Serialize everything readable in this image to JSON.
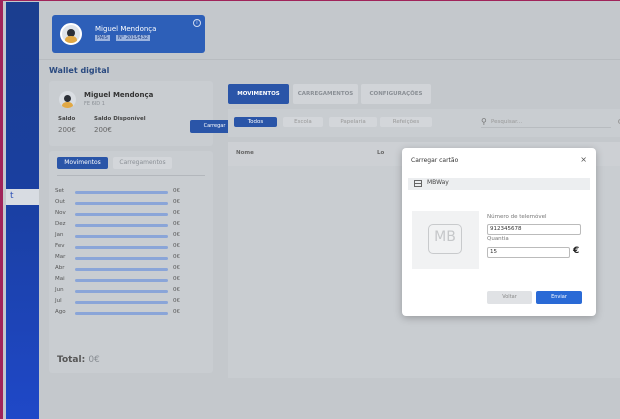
{
  "sidebar": {
    "selected_item_text": "t"
  },
  "user": {
    "name": "Miguel Mendonça",
    "badge1": "PAIS",
    "badge2": "N° 2015432",
    "info": "i"
  },
  "wallet": {
    "title": "Wallet digital",
    "name": "Miguel Mendonça",
    "sub": "FE 6ID 1",
    "saldo_label": "Saldo",
    "saldo_value": "200€",
    "disponivel_label": "Saldo Disponível",
    "disponivel_value": "200€",
    "carregar_label": "Carregar"
  },
  "history": {
    "tabs": [
      "Movimentos",
      "Carregamentos"
    ],
    "rows": [
      {
        "month": "Set",
        "value": "0€"
      },
      {
        "month": "Out",
        "value": "0€"
      },
      {
        "month": "Nov",
        "value": "0€"
      },
      {
        "month": "Dez",
        "value": "0€"
      },
      {
        "month": "Jan",
        "value": "0€"
      },
      {
        "month": "Fev",
        "value": "0€"
      },
      {
        "month": "Mar",
        "value": "0€"
      },
      {
        "month": "Abr",
        "value": "0€"
      },
      {
        "month": "Mai",
        "value": "0€"
      },
      {
        "month": "Jun",
        "value": "0€"
      },
      {
        "month": "Jul",
        "value": "0€"
      },
      {
        "month": "Ago",
        "value": "0€"
      }
    ],
    "total_label": "Total:",
    "total_value": "0€"
  },
  "main": {
    "tabs": [
      "MOVIMENTOS",
      "CARREGAMENTOS",
      "CONFIGURAÇÕES"
    ],
    "filters": [
      "Todos",
      "Escola",
      "Papelaria",
      "Refeições"
    ],
    "search_placeholder": "Pesquisar...",
    "columns": [
      "Nome",
      "Lo"
    ]
  },
  "modal": {
    "title": "Carregar cartão",
    "close": "×",
    "method": "MBWay",
    "logo_text": "MB",
    "phone_label": "Número de telemóvel",
    "phone_value": "912345678",
    "amount_label": "Quantia",
    "amount_value": "15",
    "currency": "€",
    "back_label": "Voltar",
    "send_label": "Enviar"
  }
}
